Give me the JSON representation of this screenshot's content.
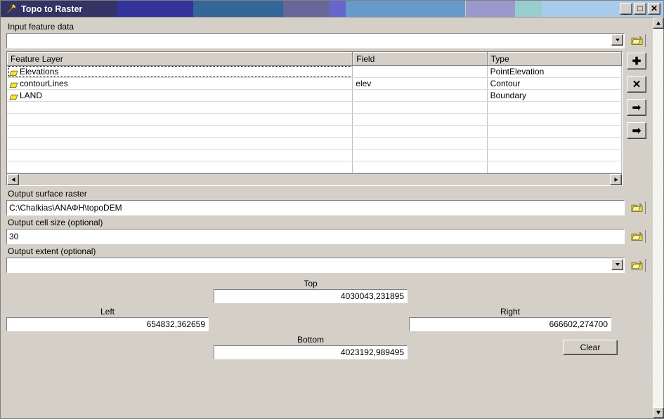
{
  "window": {
    "title": "Topo to Raster",
    "title_icon": "hammer-icon",
    "titlebar_bands": [
      "#333366",
      "#333399",
      "#336699",
      "#666699",
      "#6666cc",
      "#6699cc",
      "#9999cc",
      "#99cccc",
      "#a9cbec"
    ],
    "controls": {
      "minimize": "_",
      "maximize": "□",
      "close": "✕"
    }
  },
  "input_feature_data": {
    "label": "Input feature data",
    "value": "",
    "placeholder": "",
    "dropdown_icon": "chevron-down-icon",
    "browse_icon": "open-folder-icon"
  },
  "grid": {
    "columns": [
      "Feature Layer",
      "Field",
      "Type"
    ],
    "rows": [
      {
        "layer": "Elevations",
        "field": "",
        "type": "PointElevation",
        "icon": "feature-layer-icon",
        "focused": true
      },
      {
        "layer": "contourLines",
        "field": "elev",
        "type": "Contour",
        "icon": "feature-layer-icon",
        "focused": false
      },
      {
        "layer": "LAND",
        "field": "",
        "type": "Boundary",
        "icon": "feature-layer-icon",
        "focused": false
      }
    ],
    "empty_row_count": 6,
    "scrollbar": {
      "left_arrow": "◀",
      "right_arrow": "▶"
    }
  },
  "tools": [
    {
      "name": "add-row-button",
      "glyph": "✚",
      "icon": "plus-icon"
    },
    {
      "name": "remove-row-button",
      "glyph": "✕",
      "icon": "cross-icon"
    },
    {
      "name": "move-up-button",
      "glyph": "↑",
      "icon": "arrow-up-icon"
    },
    {
      "name": "move-down-button",
      "glyph": "↓",
      "icon": "arrow-down-icon"
    }
  ],
  "output_surface_raster": {
    "label": "Output surface raster",
    "value": "C:\\Chalkias\\ΑΝΑΦΗ\\topoDEM",
    "browse_icon": "open-folder-icon"
  },
  "output_cell_size": {
    "label": "Output cell size (optional)",
    "value": "30",
    "browse_icon": "open-folder-icon"
  },
  "output_extent": {
    "label": "Output extent (optional)",
    "value": "",
    "dropdown_icon": "chevron-down-icon",
    "browse_icon": "open-folder-icon"
  },
  "extent": {
    "top": {
      "label": "Top",
      "value": "4030043,231895"
    },
    "left": {
      "label": "Left",
      "value": "654832,362659"
    },
    "right": {
      "label": "Right",
      "value": "666602,274700"
    },
    "bottom": {
      "label": "Bottom",
      "value": "4023192,989495"
    },
    "clear_label": "Clear"
  },
  "theme": {
    "face": "#d4d0c8",
    "field": "#ffffff",
    "shadow": "#808080",
    "folder_yellow": "#e8d84a",
    "folder_dark": "#8a8208"
  }
}
